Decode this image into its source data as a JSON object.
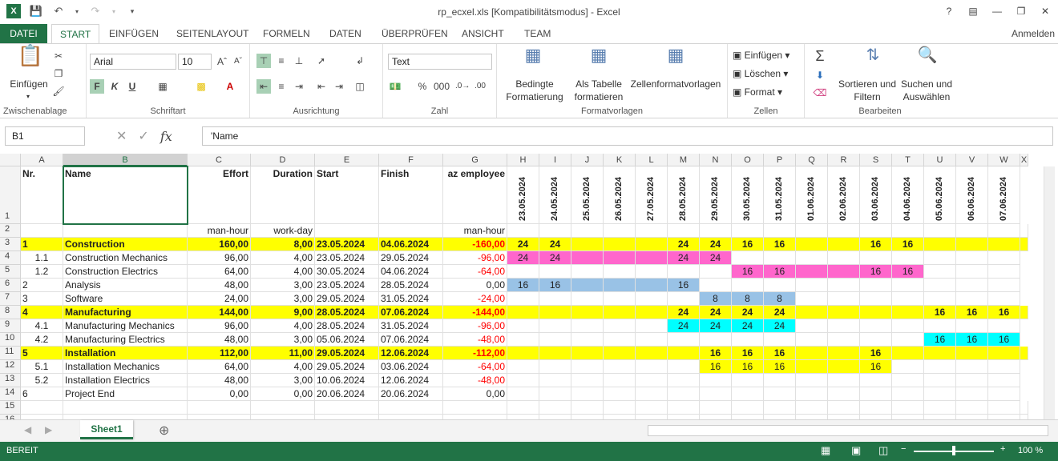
{
  "window": {
    "title": "rp_ecxel.xls  [Kompatibilitätsmodus] - Excel",
    "signin": "Anmelden"
  },
  "tabs": [
    "DATEI",
    "START",
    "EINFÜGEN",
    "SEITENLAYOUT",
    "FORMELN",
    "DATEN",
    "ÜBERPRÜFEN",
    "ANSICHT",
    "TEAM"
  ],
  "ribbon": {
    "clipboard": {
      "label": "Zwischenablage",
      "paste": "Einfügen"
    },
    "font": {
      "label": "Schriftart",
      "name": "Arial",
      "size": "10",
      "bold": "F",
      "italic": "K",
      "underline": "U"
    },
    "align": {
      "label": "Ausrichtung"
    },
    "number": {
      "label": "Zahl",
      "format": "Text",
      "percent": "%",
      "thousand": "000"
    },
    "styles": {
      "label": "Formatvorlagen",
      "cond": "Bedingte",
      "cond2": "Formatierung",
      "table": "Als Tabelle",
      "table2": "formatieren",
      "cell": "Zellenformatvorlagen"
    },
    "cells": {
      "label": "Zellen",
      "insert": "Einfügen",
      "delete": "Löschen",
      "format": "Format"
    },
    "edit": {
      "label": "Bearbeiten",
      "sort": "Sortieren und",
      "sort2": "Filtern",
      "find": "Suchen und",
      "find2": "Auswählen"
    }
  },
  "formula": {
    "namebox": "B1",
    "value": "'Name"
  },
  "columns": [
    "A",
    "B",
    "C",
    "D",
    "E",
    "F",
    "G",
    "H",
    "I",
    "J",
    "K",
    "L",
    "M",
    "N",
    "O",
    "P",
    "Q",
    "R",
    "S",
    "T",
    "U",
    "V",
    "W",
    "X"
  ],
  "dates": [
    "23.05.2024",
    "24.05.2024",
    "25.05.2024",
    "26.05.2024",
    "27.05.2024",
    "28.05.2024",
    "29.05.2024",
    "30.05.2024",
    "31.05.2024",
    "01.06.2024",
    "02.06.2024",
    "03.06.2024",
    "04.06.2024",
    "05.06.2024",
    "06.06.2024",
    "07.06.2024"
  ],
  "header": {
    "nr": "Nr.",
    "name": "Name",
    "effort": "Effort",
    "duration": "Duration",
    "start": "Start",
    "finish": "Finish",
    "employee": "az employee"
  },
  "units": {
    "effort": "man-hour",
    "duration": "work-day",
    "employee": "man-hour"
  },
  "rows": [
    {
      "n": "3",
      "nr": "1",
      "name": "Construction",
      "effort": "160,00",
      "dur": "8,00",
      "start": "23.05.2024",
      "finish": "04.06.2024",
      "emp": "-160,00",
      "bold": true,
      "summary": true
    },
    {
      "n": "4",
      "nr": "1.1",
      "name": "Construction Mechanics",
      "effort": "96,00",
      "dur": "4,00",
      "start": "23.05.2024",
      "finish": "29.05.2024",
      "emp": "-96,00"
    },
    {
      "n": "5",
      "nr": "1.2",
      "name": "Construction Electrics",
      "effort": "64,00",
      "dur": "4,00",
      "start": "30.05.2024",
      "finish": "04.06.2024",
      "emp": "-64,00"
    },
    {
      "n": "6",
      "nr": "2",
      "name": "Analysis",
      "effort": "48,00",
      "dur": "3,00",
      "start": "23.05.2024",
      "finish": "28.05.2024",
      "emp": "0,00"
    },
    {
      "n": "7",
      "nr": "3",
      "name": "Software",
      "effort": "24,00",
      "dur": "3,00",
      "start": "29.05.2024",
      "finish": "31.05.2024",
      "emp": "-24,00"
    },
    {
      "n": "8",
      "nr": "4",
      "name": "Manufacturing",
      "effort": "144,00",
      "dur": "9,00",
      "start": "28.05.2024",
      "finish": "07.06.2024",
      "emp": "-144,00",
      "bold": true,
      "summary": true
    },
    {
      "n": "9",
      "nr": "4.1",
      "name": "Manufacturing Mechanics",
      "effort": "96,00",
      "dur": "4,00",
      "start": "28.05.2024",
      "finish": "31.05.2024",
      "emp": "-96,00"
    },
    {
      "n": "10",
      "nr": "4.2",
      "name": "Manufacturing Electrics",
      "effort": "48,00",
      "dur": "3,00",
      "start": "05.06.2024",
      "finish": "07.06.2024",
      "emp": "-48,00"
    },
    {
      "n": "11",
      "nr": "5",
      "name": "Installation",
      "effort": "112,00",
      "dur": "11,00",
      "start": "29.05.2024",
      "finish": "12.06.2024",
      "emp": "-112,00",
      "bold": true,
      "summary": true
    },
    {
      "n": "12",
      "nr": "5.1",
      "name": "Installation Mechanics",
      "effort": "64,00",
      "dur": "4,00",
      "start": "29.05.2024",
      "finish": "03.06.2024",
      "emp": "-64,00"
    },
    {
      "n": "13",
      "nr": "5.2",
      "name": "Installation Electrics",
      "effort": "48,00",
      "dur": "3,00",
      "start": "10.06.2024",
      "finish": "12.06.2024",
      "emp": "-48,00"
    },
    {
      "n": "14",
      "nr": "6",
      "name": "Project End",
      "effort": "0,00",
      "dur": "0,00",
      "start": "20.06.2024",
      "finish": "20.06.2024",
      "emp": "0,00"
    }
  ],
  "gantt": [
    {
      "row": 0,
      "cells": [
        "24",
        "24",
        "",
        "",
        "",
        "24",
        "24",
        "16",
        "16",
        "",
        "",
        "16",
        "16",
        "",
        "",
        ""
      ],
      "bg": "#ffff00",
      "bold": true,
      "fill": "all"
    },
    {
      "row": 1,
      "cells": [
        "24",
        "24",
        "",
        "",
        "",
        "24",
        "24",
        "",
        "",
        "",
        "",
        "",
        "",
        "",
        "",
        ""
      ],
      "bg": "#ff66cc",
      "range": [
        0,
        6
      ]
    },
    {
      "row": 2,
      "cells": [
        "",
        "",
        "",
        "",
        "",
        "",
        "",
        "16",
        "16",
        "",
        "",
        "16",
        "16",
        "",
        "",
        ""
      ],
      "bg": "#ff66cc",
      "range": [
        7,
        12
      ]
    },
    {
      "row": 3,
      "cells": [
        "16",
        "16",
        "",
        "",
        "",
        "16",
        "",
        "",
        "",
        "",
        "",
        "",
        "",
        "",
        "",
        ""
      ],
      "bg": "#99c2e6",
      "range": [
        0,
        5
      ]
    },
    {
      "row": 4,
      "cells": [
        "",
        "",
        "",
        "",
        "",
        "",
        "8",
        "8",
        "8",
        "",
        "",
        "",
        "",
        "",
        "",
        ""
      ],
      "bg": "#99c2e6",
      "range": [
        6,
        8
      ]
    },
    {
      "row": 5,
      "cells": [
        "",
        "",
        "",
        "",
        "",
        "24",
        "24",
        "24",
        "24",
        "",
        "",
        "",
        "",
        "16",
        "16",
        "16"
      ],
      "bg": "#ffff00",
      "bold": true,
      "fill": "all"
    },
    {
      "row": 6,
      "cells": [
        "",
        "",
        "",
        "",
        "",
        "24",
        "24",
        "24",
        "24",
        "",
        "",
        "",
        "",
        "",
        "",
        ""
      ],
      "bg": "#00ffff",
      "range": [
        5,
        8
      ]
    },
    {
      "row": 7,
      "cells": [
        "",
        "",
        "",
        "",
        "",
        "",
        "",
        "",
        "",
        "",
        "",
        "",
        "",
        "16",
        "16",
        "16"
      ],
      "bg": "#00ffff",
      "range": [
        13,
        15
      ]
    },
    {
      "row": 8,
      "cells": [
        "",
        "",
        "",
        "",
        "",
        "",
        "16",
        "16",
        "16",
        "",
        "",
        "16",
        "",
        "",
        "",
        ""
      ],
      "bg": "#ffff00",
      "bold": true,
      "fill": "all"
    },
    {
      "row": 9,
      "cells": [
        "",
        "",
        "",
        "",
        "",
        "",
        "16",
        "16",
        "16",
        "",
        "",
        "16",
        "",
        "",
        "",
        ""
      ],
      "bg": "#ffff00",
      "range": [
        6,
        11
      ]
    },
    {
      "row": 10,
      "cells": [
        "",
        "",
        "",
        "",
        "",
        "",
        "",
        "",
        "",
        "",
        "",
        "",
        "",
        "",
        "",
        ""
      ],
      "bg": "#ffffff",
      "range": [
        0,
        -1
      ]
    },
    {
      "row": 11,
      "cells": [
        "",
        "",
        "",
        "",
        "",
        "",
        "",
        "",
        "",
        "",
        "",
        "",
        "",
        "",
        "",
        ""
      ],
      "bg": "#ffffff",
      "range": [
        0,
        -1
      ]
    }
  ],
  "sheet": {
    "name": "Sheet1"
  },
  "status": {
    "mode": "BEREIT",
    "zoom": "100 %"
  }
}
